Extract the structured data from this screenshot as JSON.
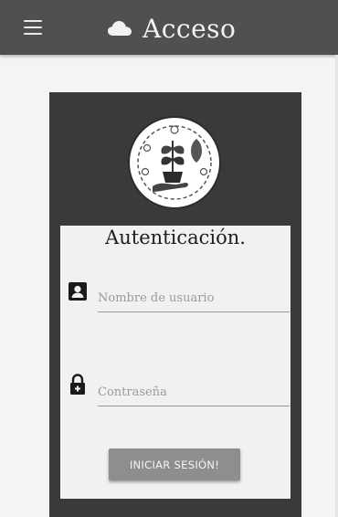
{
  "appbar": {
    "title": "Acceso",
    "menu_icon": "hamburger-menu-icon",
    "title_icon": "cloud-icon"
  },
  "login": {
    "logo_icon": "plant-in-hand-logo",
    "heading": "Autenticación.",
    "username": {
      "icon": "account-box-icon",
      "placeholder": "Nombre de usuario",
      "value": ""
    },
    "password": {
      "icon": "lock-plus-icon",
      "placeholder": "Contraseña",
      "value": ""
    },
    "submit_label": "INICIAR SESIÓN!"
  },
  "colors": {
    "appbar": "#505050",
    "card": "#3a3a3a",
    "panel": "#f1f1f1",
    "button": "#8e8e8e"
  }
}
